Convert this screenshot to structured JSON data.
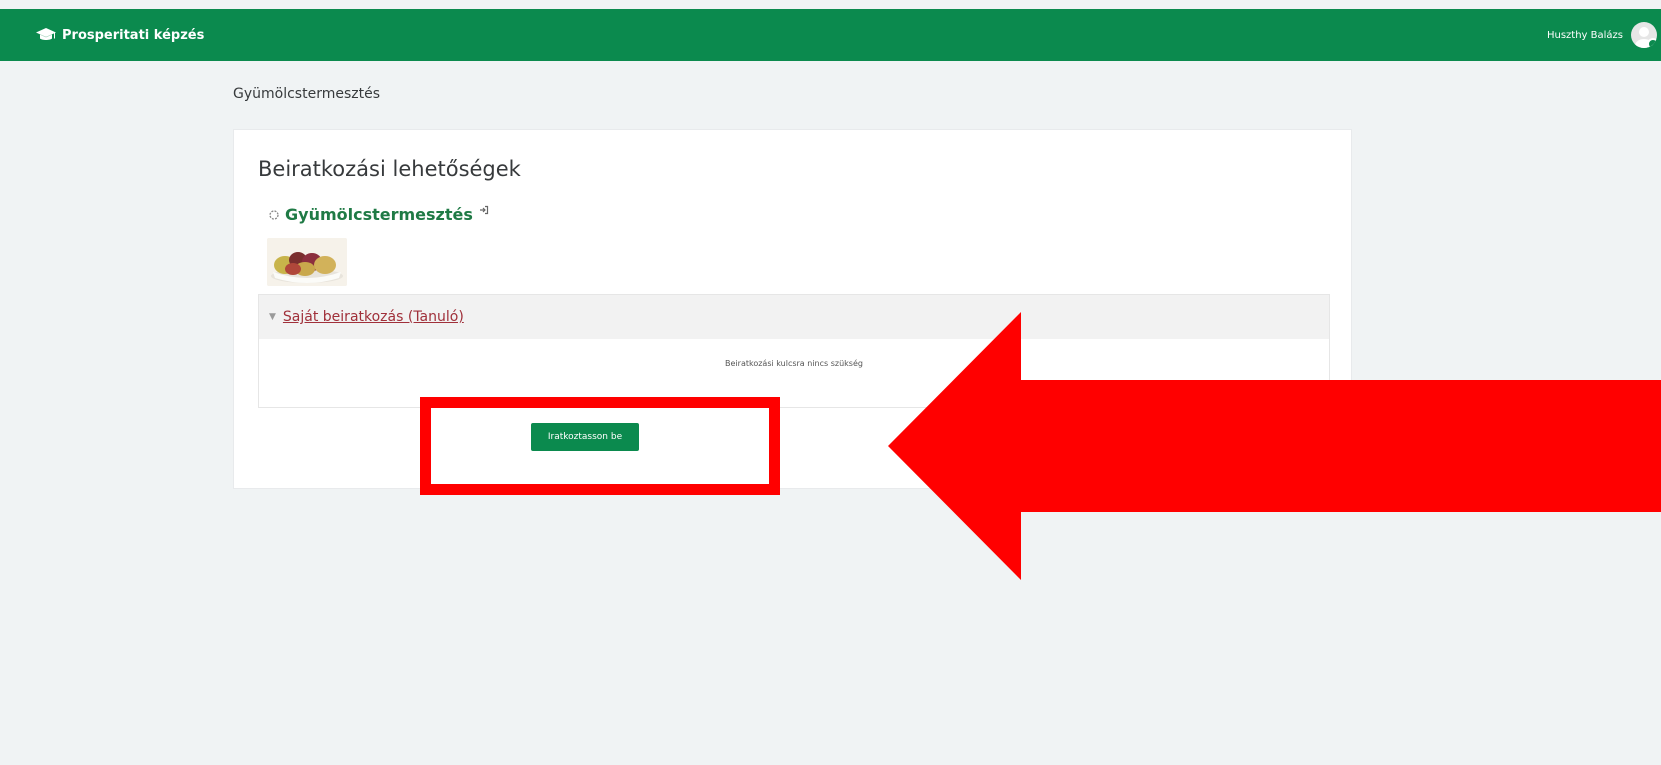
{
  "header": {
    "brand": "Prosperitati képzés",
    "brand_icon": "graduation-cap-icon",
    "user_name": "Huszthy Balázs",
    "bg_color": "#0b8a4e"
  },
  "breadcrumb": {
    "course": "Gyümölcstermesztés"
  },
  "main": {
    "page_title": "Beiratkozási lehetőségek",
    "course_name": "Gyümölcstermesztés",
    "section": {
      "title": "Saját beiratkozás (Tanuló)",
      "message": "Beiratkozási kulcsra nincs szükség"
    },
    "enrol_button": "Iratkoztasson be"
  },
  "annotation": {
    "box_color": "#ff0000",
    "arrow_color": "#ff0000"
  }
}
